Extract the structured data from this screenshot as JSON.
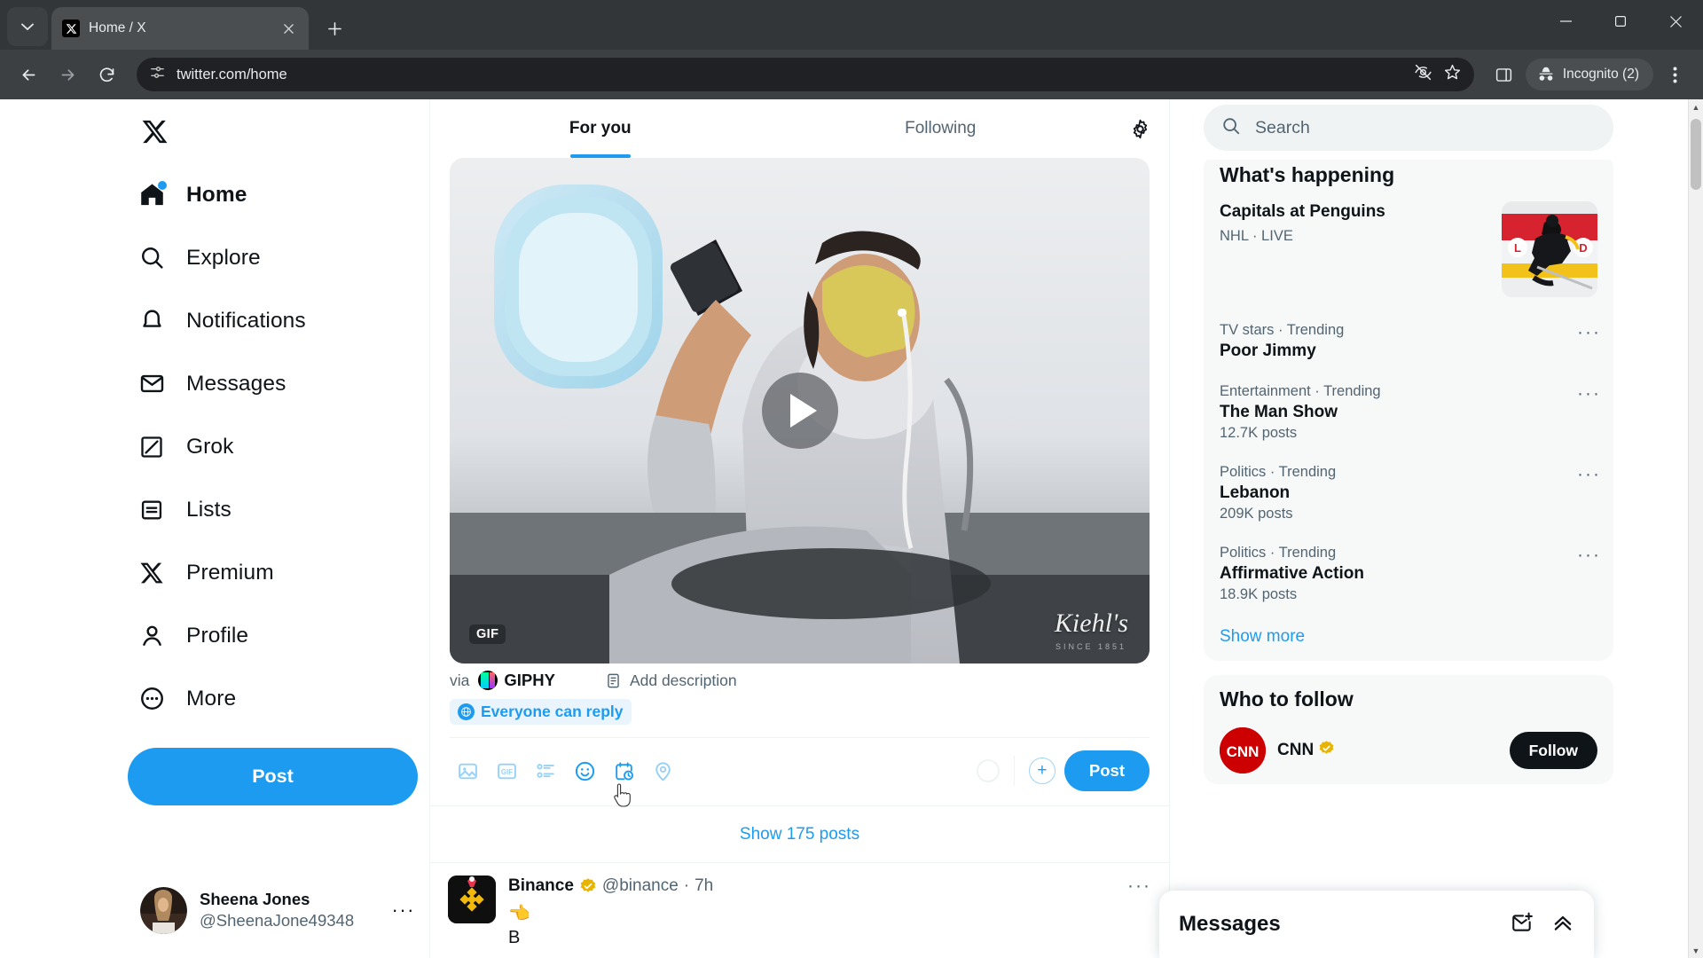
{
  "browser": {
    "tab": {
      "title": "Home / X",
      "favicon": "x-logo-icon"
    },
    "url": "twitter.com/home",
    "profile_label": "Incognito (2)",
    "icons": {
      "tab_list": "chevron-down-icon",
      "new_tab": "plus-icon",
      "back": "back-arrow-icon",
      "forward": "forward-arrow-icon",
      "reload": "reload-icon",
      "site_info": "site-settings-icon",
      "third_party_cookies": "eye-slash-icon",
      "bookmark": "star-icon",
      "side_panel": "side-panel-icon",
      "menu": "three-dot-menu-icon",
      "minimize": "minimize-icon",
      "maximize": "maximize-icon",
      "close": "close-icon"
    }
  },
  "sidebar": {
    "logo": "x-logo-icon",
    "items": [
      {
        "label": "Home",
        "icon": "home-icon",
        "active": true,
        "badge_dot": true
      },
      {
        "label": "Explore",
        "icon": "search-icon",
        "active": false,
        "badge_dot": false
      },
      {
        "label": "Notifications",
        "icon": "bell-icon",
        "active": false,
        "badge_dot": false
      },
      {
        "label": "Messages",
        "icon": "envelope-icon",
        "active": false,
        "badge_dot": false
      },
      {
        "label": "Grok",
        "icon": "grok-icon",
        "active": false,
        "badge_dot": false
      },
      {
        "label": "Lists",
        "icon": "lists-icon",
        "active": false,
        "badge_dot": false
      },
      {
        "label": "Premium",
        "icon": "x-premium-icon",
        "active": false,
        "badge_dot": false
      },
      {
        "label": "Profile",
        "icon": "person-icon",
        "active": false,
        "badge_dot": false
      },
      {
        "label": "More",
        "icon": "more-circle-icon",
        "active": false,
        "badge_dot": false
      }
    ],
    "post_button": "Post",
    "account": {
      "name": "Sheena Jones",
      "handle": "@SheenaJone49348",
      "more": "···"
    }
  },
  "timeline": {
    "tabs": [
      {
        "label": "For you",
        "selected": true
      },
      {
        "label": "Following",
        "selected": false
      }
    ],
    "settings_icon": "gear-icon",
    "composer": {
      "media": {
        "type": "gif",
        "badge": "GIF",
        "play_icon": "play-icon",
        "watermark": "Kiehl's",
        "watermark_sub": "SINCE 1851"
      },
      "via_label": "via",
      "via_provider": "GIPHY",
      "add_description": "Add description",
      "reply_scope": "Everyone can reply",
      "actions": [
        {
          "icon": "image-icon",
          "disabled": true
        },
        {
          "icon": "gif-icon",
          "disabled": true
        },
        {
          "icon": "poll-icon",
          "disabled": true
        },
        {
          "icon": "emoji-icon",
          "disabled": false
        },
        {
          "icon": "schedule-icon",
          "disabled": false
        },
        {
          "icon": "location-icon",
          "disabled": true
        }
      ],
      "add_post_icon": "plus-icon",
      "post_button": "Post"
    },
    "show_posts": "Show 175 posts",
    "posts": [
      {
        "author": "Binance",
        "verified": true,
        "handle": "@binance",
        "time": "7h",
        "separator": "·",
        "more": "···",
        "text": "👈\nB"
      }
    ]
  },
  "rightbar": {
    "search": {
      "placeholder": "Search",
      "icon": "search-icon"
    },
    "whats_happening": {
      "title": "What's happening",
      "featured": {
        "name": "Capitals at Penguins",
        "meta": "NHL · LIVE",
        "thumb": "nhl-hockey-thumbnail"
      },
      "trends": [
        {
          "category": "TV stars · Trending",
          "name": "Poor Jimmy",
          "count": ""
        },
        {
          "category": "Entertainment · Trending",
          "name": "The Man Show",
          "count": "12.7K posts"
        },
        {
          "category": "Politics · Trending",
          "name": "Lebanon",
          "count": "209K posts"
        },
        {
          "category": "Politics · Trending",
          "name": "Affirmative Action",
          "count": "18.9K posts"
        }
      ],
      "show_more": "Show more"
    },
    "who_to_follow": {
      "title": "Who to follow",
      "suggestions": [
        {
          "name": "CNN",
          "verified": true,
          "follow": "Follow"
        }
      ]
    }
  },
  "messages_dock": {
    "title": "Messages",
    "icons": {
      "new_message": "new-message-icon",
      "expand": "chevron-up-double-icon"
    }
  },
  "colors": {
    "accent": "#1d9bf0",
    "text_primary": "#0f1419",
    "text_secondary": "#536471",
    "border": "#eff3f4",
    "card_bg": "#f7f9f9",
    "chrome_bg": "#3c4043",
    "chrome_dark": "#323639",
    "omnibox_bg": "#202124"
  }
}
